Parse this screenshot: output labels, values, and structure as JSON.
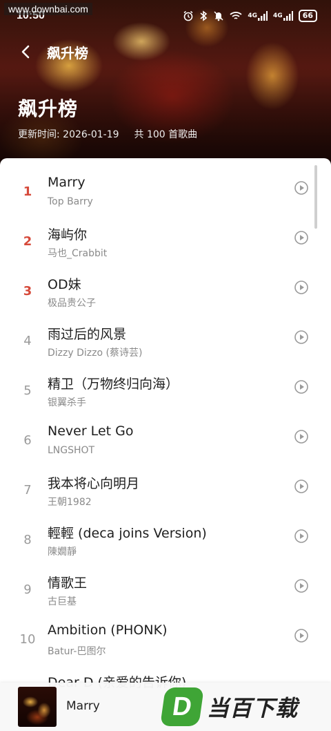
{
  "watermark": "www.downbai.com",
  "status_bar": {
    "time": "10:50",
    "network_1": "4G",
    "network_2": "4G",
    "battery": "66"
  },
  "header": {
    "nav_title": "飙升榜",
    "title": "飙升榜",
    "update_time": "更新时间: 2026-01-19",
    "song_count": "共 100 首歌曲"
  },
  "colors": {
    "rank_highlight": "#d64a3b",
    "rank_normal": "#9a9a9a",
    "brand_green": "#3fa536"
  },
  "songs": [
    {
      "rank": "1",
      "title": "Marry",
      "artist": "Top Barry"
    },
    {
      "rank": "2",
      "title": "海屿你",
      "artist": "马也_Crabbit"
    },
    {
      "rank": "3",
      "title": "OD妹",
      "artist": "极品贵公子"
    },
    {
      "rank": "4",
      "title": "雨过后的风景",
      "artist": "Dizzy Dizzo (蔡诗芸)"
    },
    {
      "rank": "5",
      "title": "精卫（万物终归向海）",
      "artist": "银翼杀手"
    },
    {
      "rank": "6",
      "title": "Never Let Go",
      "artist": "LNGSHOT"
    },
    {
      "rank": "7",
      "title": "我本将心向明月",
      "artist": "王朝1982"
    },
    {
      "rank": "8",
      "title": "輕輕 (deca joins Version)",
      "artist": "陳嫺靜"
    },
    {
      "rank": "9",
      "title": "情歌王",
      "artist": "古巨基"
    },
    {
      "rank": "10",
      "title": "Ambition (PHONK)",
      "artist": "Batur-巴图尔"
    },
    {
      "rank": "",
      "title": "Dear D (亲爱的告诉你)",
      "artist": ""
    }
  ],
  "mini_player": {
    "title": "Marry"
  },
  "brand": {
    "logo_letter": "D",
    "text": "当百下载"
  }
}
